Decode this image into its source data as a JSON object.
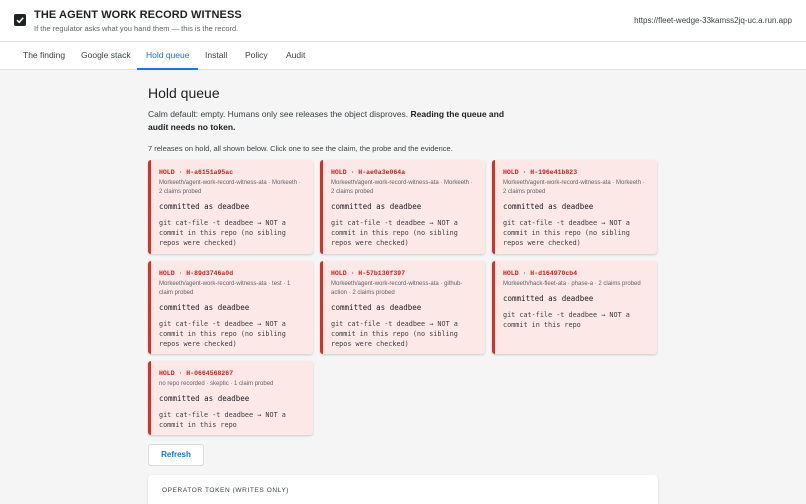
{
  "header": {
    "title": "THE AGENT WORK RECORD WITNESS",
    "subtitle": "If the regulator asks what you hand them — this is the record.",
    "url": "https://fleet-wedge-33kamss2jq-uc.a.run.app",
    "logo_icon": "checkbox-icon"
  },
  "tabs": [
    {
      "label": "The finding"
    },
    {
      "label": "Google stack"
    },
    {
      "label": "Hold queue",
      "active": true
    },
    {
      "label": "Install"
    },
    {
      "label": "Policy"
    },
    {
      "label": "Audit"
    }
  ],
  "main": {
    "title": "Hold queue",
    "intro_plain": "Calm default: empty. Humans only see releases the object disproves. ",
    "intro_bold": "Reading the queue and audit needs no token.",
    "count_line": "7 releases on hold, all shown below. Click one to see the claim, the probe and the evidence.",
    "refresh_label": "Refresh",
    "token_label": "OPERATOR TOKEN (WRITES ONLY)"
  },
  "cards": [
    {
      "id": "HOLD · H-a6151a95ac",
      "repo": "Morkeeth/agent-work-record-witness-ata · Morkeeth · 2 claims probed",
      "claim": "committed as deadbee",
      "probe": "git cat-file -t deadbee → NOT a commit in this repo (no sibling repos were checked)"
    },
    {
      "id": "HOLD · H-ae0a3e064a",
      "repo": "Morkeeth/agent-work-record-witness-ata · Morkeeth · 2 claims probed",
      "claim": "committed as deadbee",
      "probe": "git cat-file -t deadbee → NOT a commit in this repo (no sibling repos were checked)"
    },
    {
      "id": "HOLD · H-196e41b823",
      "repo": "Morkeeth/agent-work-record-witness-ata · Morkeeth · 2 claims probed",
      "claim": "committed as deadbee",
      "probe": "git cat-file -t deadbee → NOT a commit in this repo (no sibling repos were checked)"
    },
    {
      "id": "HOLD · H-89d3746a0d",
      "repo": "Morkeeth/agent-work-record-witness-ata · test · 1 claim probed",
      "claim": "committed as deadbee",
      "probe": "git cat-file -t deadbee → NOT a commit in this repo (no sibling repos were checked)"
    },
    {
      "id": "HOLD · H-57b130f397",
      "repo": "Morkeeth/agent-work-record-witness-ata · github-action · 2 claims probed",
      "claim": "committed as deadbee",
      "probe": "git cat-file -t deadbee → NOT a commit in this repo (no sibling repos were checked)"
    },
    {
      "id": "HOLD · H-d164970cb4",
      "repo": "Morkeeth/hack-fleet-ata · phase-a · 2 claims probed",
      "claim": "committed as deadbee",
      "probe": "git cat-file -t deadbee → NOT a commit in this repo"
    },
    {
      "id": "HOLD · H-0664568267",
      "repo": "no repo recorded · skeptic · 1 claim probed",
      "claim": "committed as deadbee",
      "probe": "git cat-file -t deadbee → NOT a commit in this repo"
    }
  ]
}
